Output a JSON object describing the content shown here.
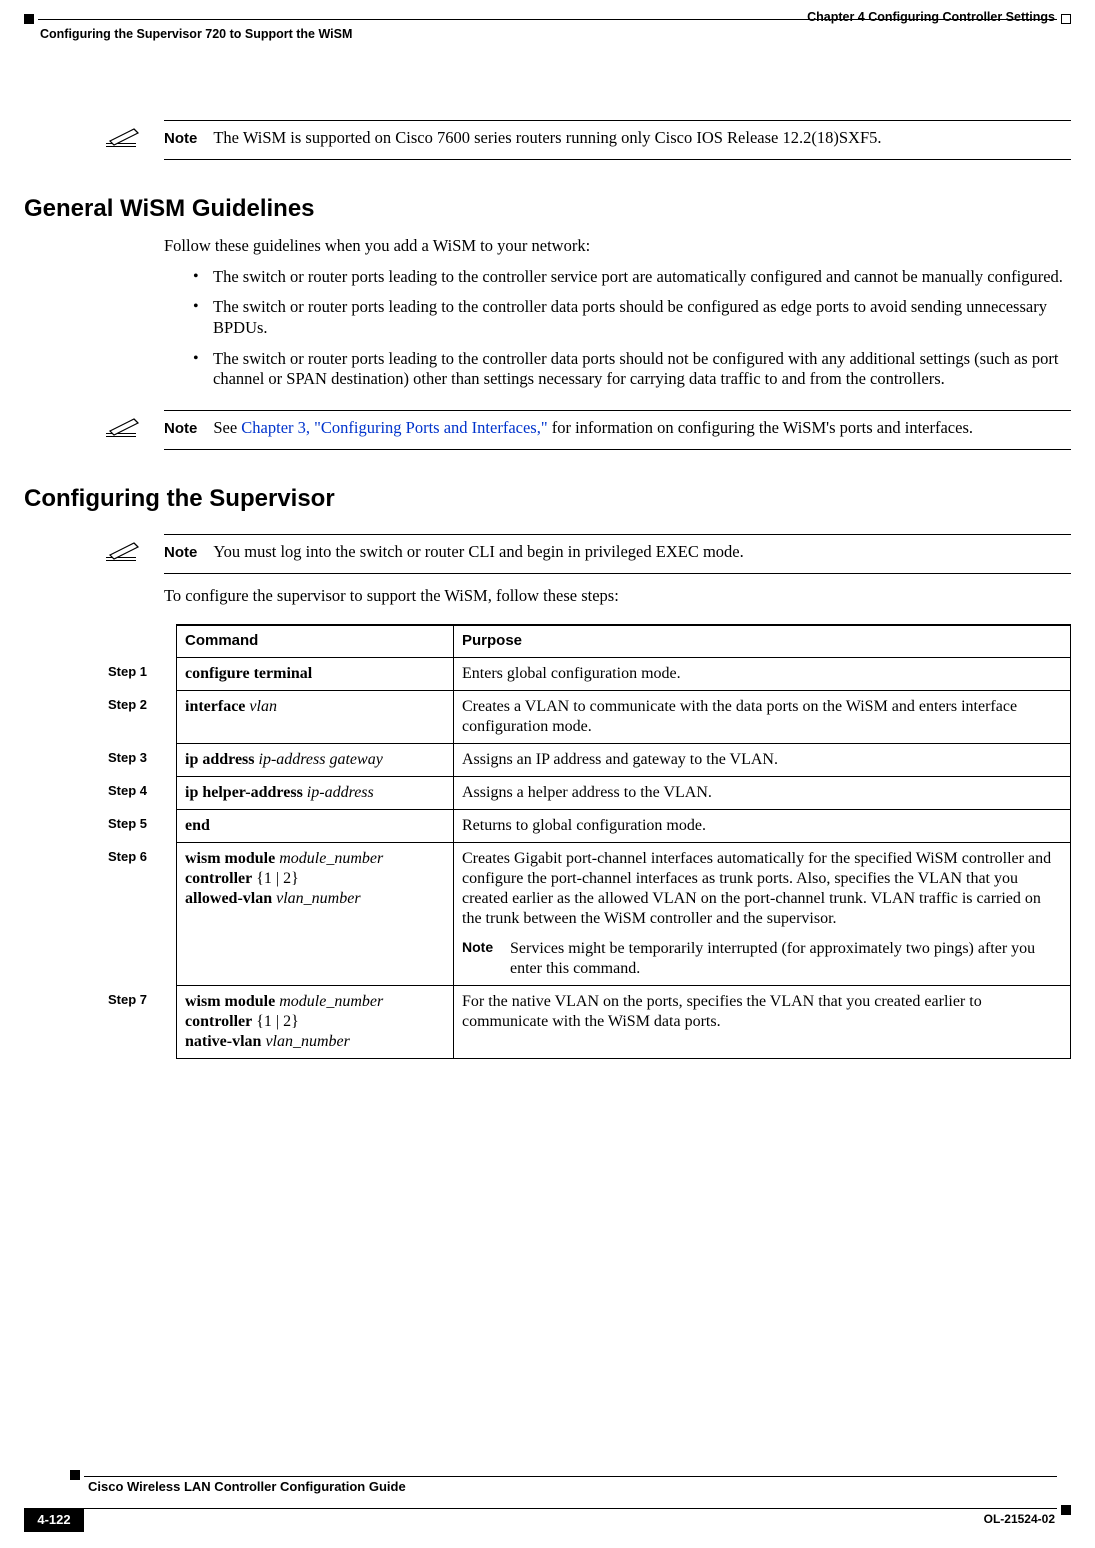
{
  "header": {
    "chapter_right": "Chapter 4      Configuring Controller Settings",
    "section_left": "Configuring the Supervisor 720 to Support the WiSM"
  },
  "note1": {
    "label": "Note",
    "text": "The WiSM is supported on Cisco 7600 series routers running only Cisco IOS Release 12.2(18)SXF5."
  },
  "section_guidelines": {
    "title": "General WiSM Guidelines",
    "intro": "Follow these guidelines when you add a WiSM to your network:",
    "bullets": [
      "The switch or router ports leading to the controller service port are automatically configured and cannot be manually configured.",
      "The switch or router ports leading to the controller data ports should be configured as edge ports to avoid sending unnecessary BPDUs.",
      "The switch or router ports leading to the controller data ports should not be configured with any additional settings (such as port channel or SPAN destination) other than settings necessary for carrying data traffic to and from the controllers."
    ]
  },
  "note2": {
    "label": "Note",
    "pre": "See ",
    "link": "Chapter 3, \"Configuring Ports and Interfaces,\"",
    "post": " for information on configuring the WiSM's ports and interfaces."
  },
  "section_config": {
    "title": "Configuring the Supervisor"
  },
  "note3": {
    "label": "Note",
    "text": "You must log into the switch or router CLI and begin in privileged EXEC mode."
  },
  "para_steps": "To configure the supervisor to support the WiSM, follow these steps:",
  "table": {
    "headers": {
      "command": "Command",
      "purpose": "Purpose"
    },
    "rows": [
      {
        "step": "Step 1",
        "cmd_bold1": "configure terminal",
        "purpose": "Enters global configuration mode."
      },
      {
        "step": "Step 2",
        "cmd_bold1": "interface",
        "cmd_ital1": "vlan",
        "purpose": "Creates a VLAN to communicate with the data ports on the WiSM and enters interface configuration mode."
      },
      {
        "step": "Step 3",
        "cmd_bold1": "ip address",
        "cmd_ital1": "ip-address gateway",
        "purpose": "Assigns an IP address and gateway to the VLAN."
      },
      {
        "step": "Step 4",
        "cmd_bold1": "ip helper-address",
        "cmd_ital1": "ip-address",
        "purpose": "Assigns a helper address to the VLAN."
      },
      {
        "step": "Step 5",
        "cmd_bold1": "end",
        "purpose": "Returns to global configuration mode."
      },
      {
        "step": "Step 6",
        "cmd_bold1": "wism module",
        "cmd_ital1": "module_number",
        "cmd_bold2": "controller",
        "cmd_plain2": "{1 | 2}",
        "cmd_bold3": "allowed-vlan",
        "cmd_ital3": "vlan_number",
        "purpose": "Creates Gigabit port-channel interfaces automatically for the specified WiSM controller and configure the port-channel interfaces as trunk ports. Also, specifies the VLAN that you created earlier as the allowed VLAN on the port-channel trunk. VLAN traffic is carried on the trunk between the WiSM controller and the supervisor.",
        "note_label": "Note",
        "note_text": "Services might be temporarily interrupted (for approximately two pings) after you enter this command."
      },
      {
        "step": "Step 7",
        "cmd_bold1": "wism module",
        "cmd_ital1": "module_number",
        "cmd_bold2": "controller",
        "cmd_plain2": "{1 | 2}",
        "cmd_bold3": "native-vlan",
        "cmd_ital3": "vlan_number",
        "purpose": "For the native VLAN on the ports, specifies the VLAN that you created earlier to communicate with the WiSM data ports."
      }
    ]
  },
  "footer": {
    "book": "Cisco Wireless LAN Controller Configuration Guide",
    "page": "4-122",
    "docid": "OL-21524-02"
  }
}
